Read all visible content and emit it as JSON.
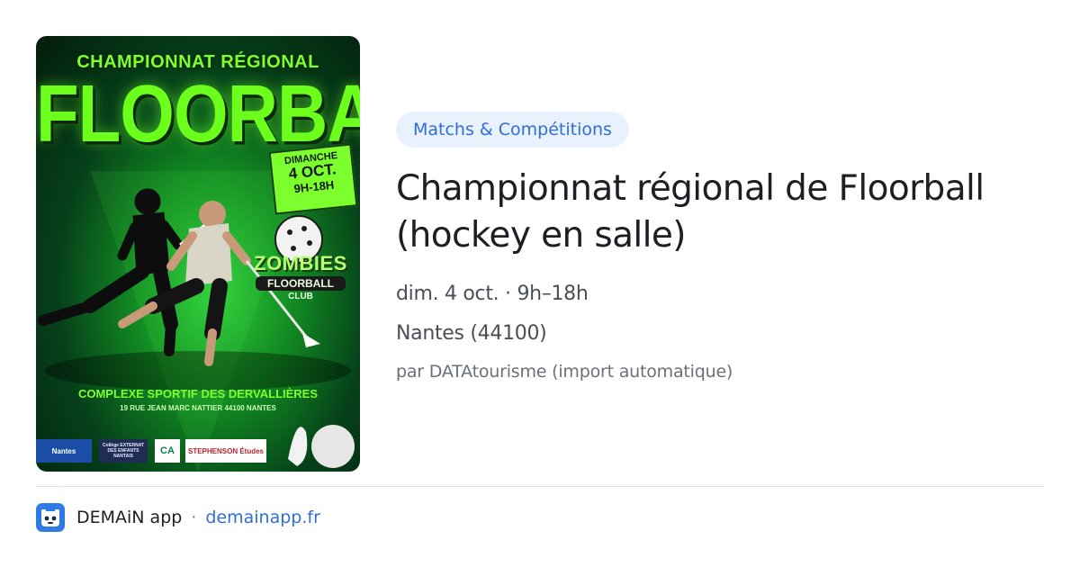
{
  "poster": {
    "subtitle": "CHAMPIONNAT RÉGIONAL",
    "title": "FLOORBALL",
    "date_day": "DIMANCHE",
    "date": "4 OCT.",
    "time": "9H-18H",
    "club_name": "ZOMBIES",
    "club_line2": "FLOORBALL",
    "club_line3": "CLUB",
    "venue": "COMPLEXE SPORTIF DES DERVALLIÈRES",
    "address": "19 RUE JEAN MARC NATTIER 44100 NANTES",
    "sponsors": [
      "Nantes",
      "Collège EXTERNAT DES ENFANTS NANTAIS",
      "CA",
      "STEPHENSON Études"
    ]
  },
  "event": {
    "category": "Matchs & Compétitions",
    "title_line1": "Championnat régional de Floorball",
    "title_line2": "(hockey en salle)",
    "datetime": "dim. 4 oct. · 9h–18h",
    "location": "Nantes (44100)",
    "author": "par DATAtourisme (import automatique)"
  },
  "footer": {
    "app_name": "DEMAiN app",
    "separator": "·",
    "domain": "demainapp.fr"
  },
  "icons": {
    "app_icon": "demain-app-icon"
  },
  "colors": {
    "accent": "#2f6fd6",
    "tag_background": "#e9f1fc",
    "poster_green": "#6cff1c"
  }
}
